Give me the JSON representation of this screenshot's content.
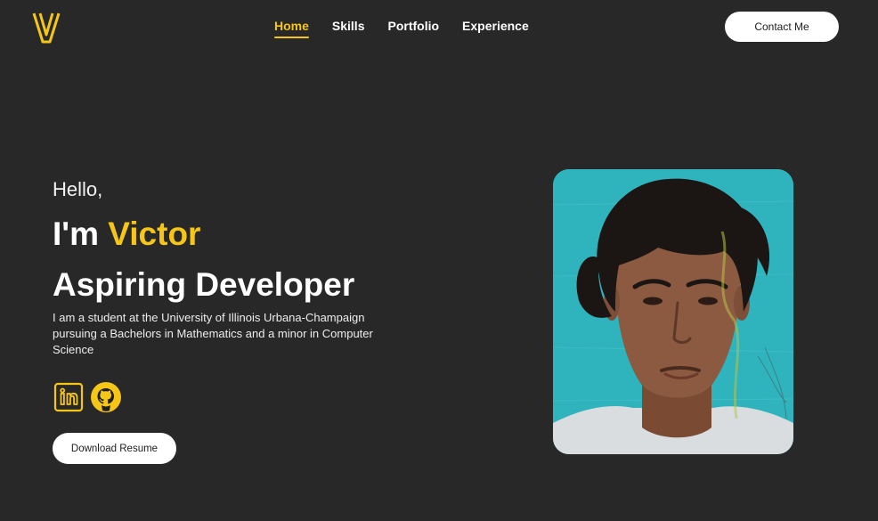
{
  "header": {
    "logo_letter": "V",
    "nav": [
      {
        "label": "Home",
        "active": true
      },
      {
        "label": "Skills",
        "active": false
      },
      {
        "label": "Portfolio",
        "active": false
      },
      {
        "label": "Experience",
        "active": false
      }
    ],
    "contact_label": "Contact Me"
  },
  "hero": {
    "greeting": "Hello,",
    "name_prefix": "I'm ",
    "name": "Victor",
    "role": "Aspiring Developer",
    "bio": "I am a student at the University of Illinois Urbana-Champaign pursuing a Bachelors in Mathematics and a minor in Computer Science",
    "socials": [
      {
        "icon": "linkedin-icon"
      },
      {
        "icon": "github-icon"
      }
    ],
    "resume_label": "Download Resume"
  },
  "colors": {
    "background": "#282828",
    "accent": "#f5c518",
    "text": "#ffffff",
    "button_bg": "#ffffff",
    "button_text": "#1e1e1e",
    "photo_bg": "#2fb4bd"
  }
}
